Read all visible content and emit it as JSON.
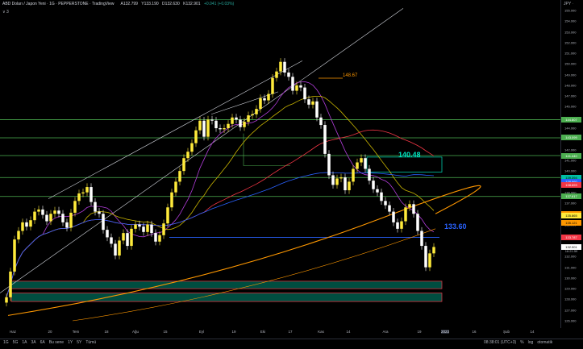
{
  "header": {
    "title": "ABD Doları / Japon Yeni · 1G · PEPPERSTONE · TradingView",
    "ohlc": [
      "A132.799",
      "Y133.190",
      "D132.630",
      "K132.901",
      "+0.041 (+0.03%)"
    ],
    "sub": "∨ 3"
  },
  "currency": "JPY ∙",
  "price_axis": [
    "155.000",
    "154.000",
    "153.000",
    "152.000",
    "151.000",
    "150.000",
    "149.000",
    "148.000",
    "147.000",
    "146.000",
    "145.000",
    "144.000",
    "143.000",
    "142.000",
    "141.000",
    "140.000",
    "139.000",
    "138.000",
    "137.000",
    "136.000",
    "135.000",
    "134.000",
    "133.000",
    "132.000",
    "131.000",
    "130.000",
    "129.000",
    "128.000",
    "127.000",
    "126.000"
  ],
  "price_labels": [
    {
      "text": "144.807",
      "color": "#4caf50"
    },
    {
      "text": "143.099",
      "color": "#4caf50"
    },
    {
      "text": "141.440",
      "color": "#4caf50"
    },
    {
      "text": "139.394",
      "color": "#00bfa5"
    },
    {
      "text": "138.960",
      "color": "#2962ff"
    },
    {
      "text": "138.693",
      "color": "#f23645"
    },
    {
      "text": "137.617",
      "color": "#4caf50"
    },
    {
      "text": "136.003",
      "color": "#ff9800"
    },
    {
      "text": "135.865",
      "color": "#ffeb3b"
    },
    {
      "text": "135.121",
      "color": "#ff9800"
    },
    {
      "text": "133.787",
      "color": "#f23645"
    },
    {
      "text": "132.901",
      "color": "#ffffff"
    },
    {
      "text": "16:21:59",
      "color": "#ffffff"
    }
  ],
  "annotations": {
    "a1": {
      "text": "148.67",
      "color": "#ff9800"
    },
    "a2": {
      "text": "140.48",
      "color": "#00e5c0"
    },
    "a3": {
      "text": "133.60",
      "color": "#2962ff"
    }
  },
  "time_axis": [
    "Haz",
    "20",
    "Tem",
    "18",
    "Ağu",
    "15",
    "Eyl",
    "19",
    "Eki",
    "17",
    "Kas",
    "14",
    "Ara",
    "19",
    "2023",
    "16",
    "Şub",
    "14"
  ],
  "toolbar": {
    "timeframes": [
      "1G",
      "5G",
      "1A",
      "3A",
      "6A",
      "Bu sene",
      "1Y",
      "5Y",
      "Tümü"
    ],
    "clock": "08:38:01 (UTC+3)",
    "percent": "%",
    "log": "log",
    "auto": "otomatik"
  },
  "chart_data": {
    "type": "candlestick",
    "symbol": "USDJPY",
    "last": 132.901,
    "ylim": [
      126,
      155
    ],
    "closes": [
      128.2,
      130.6,
      133.6,
      134.4,
      135.2,
      134.8,
      135.4,
      136.2,
      136.4,
      135.9,
      135.3,
      136.0,
      136.3,
      136.0,
      135.2,
      134.7,
      136.1,
      137.2,
      137.9,
      138.0,
      138.5,
      137.1,
      136.2,
      136.0,
      134.5,
      133.8,
      133.2,
      132.1,
      133.5,
      134.2,
      133.0,
      134.6,
      135.0,
      134.8,
      134.3,
      135.0,
      134.2,
      133.4,
      134.0,
      135.1,
      136.6,
      138.0,
      139.0,
      140.0,
      141.2,
      141.8,
      142.6,
      143.8,
      144.7,
      143.2,
      144.8,
      144.7,
      144.0,
      143.9,
      144.0,
      144.4,
      145.0,
      144.8,
      144.1,
      144.6,
      145.2,
      145.3,
      145.8,
      146.8,
      146.6,
      147.2,
      148.7,
      149.3,
      150.2,
      149.2,
      148.8,
      147.5,
      148.0,
      147.8,
      146.7,
      146.2,
      146.5,
      145.0,
      144.3,
      141.6,
      139.6,
      138.7,
      139.3,
      139.4,
      138.2,
      139.0,
      140.2,
      140.8,
      141.2,
      140.2,
      139.1,
      138.3,
      138.0,
      137.2,
      136.8,
      136.2,
      135.2,
      134.6,
      135.3,
      136.6,
      136.9,
      136.0,
      134.4,
      133.0,
      131.0,
      132.3,
      132.9
    ]
  }
}
